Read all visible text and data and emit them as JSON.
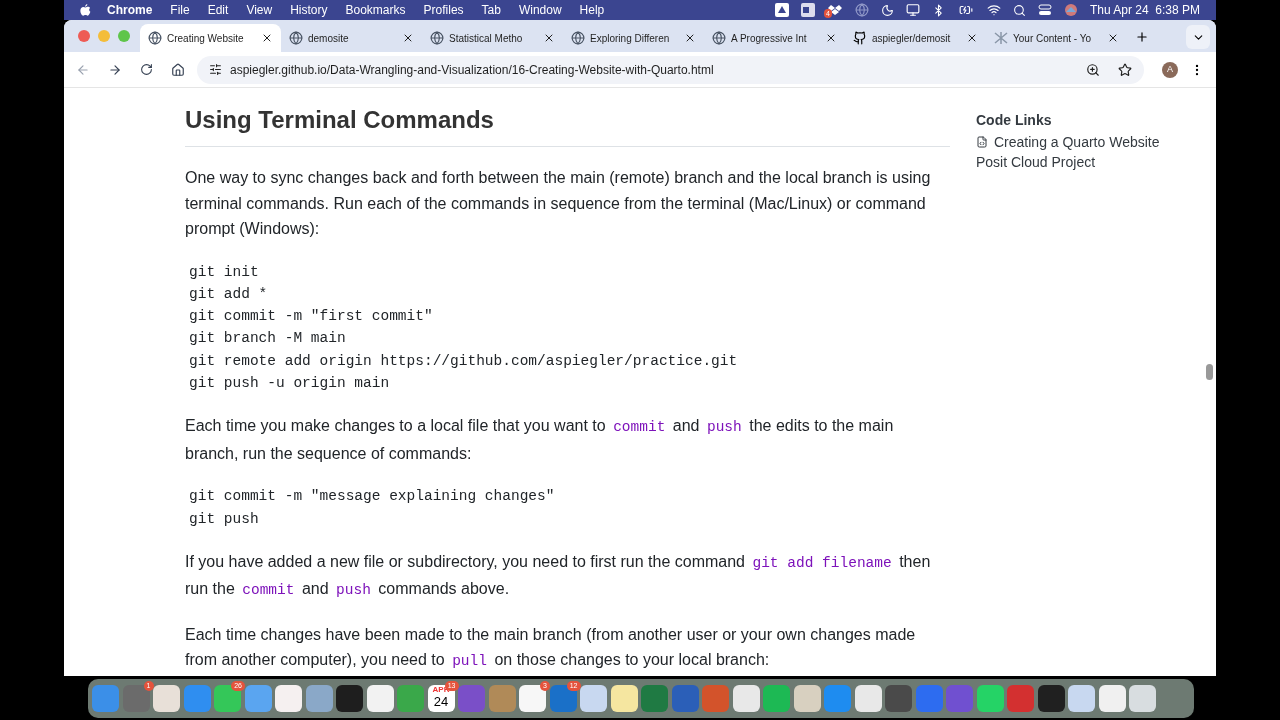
{
  "menu_bar": {
    "items": [
      "Chrome",
      "File",
      "Edit",
      "View",
      "History",
      "Bookmarks",
      "Profiles",
      "Tab",
      "Window",
      "Help"
    ],
    "dropbox_badge": "4",
    "clock": "Thu Apr 24  6:38 PM"
  },
  "tabs": [
    {
      "title": "Creating Website",
      "kind": "globe",
      "selected": true
    },
    {
      "title": "demosite",
      "kind": "globe",
      "selected": false
    },
    {
      "title": "Statistical Metho",
      "kind": "globe",
      "selected": false
    },
    {
      "title": "Exploring Differen",
      "kind": "globe",
      "selected": false
    },
    {
      "title": "A Progressive Int",
      "kind": "globe",
      "selected": false
    },
    {
      "title": "aspiegler/demosit",
      "kind": "github",
      "selected": false
    },
    {
      "title": "Your Content - Yo",
      "kind": "quarto",
      "selected": false
    }
  ],
  "address_bar": {
    "url": "aspiegler.github.io/Data-Wrangling-and-Visualization/16-Creating-Website-with-Quarto.html",
    "profile_initial": "A"
  },
  "article": {
    "heading": "Using Terminal Commands",
    "blocks": [
      {
        "kind": "paragraph",
        "segments": [
          {
            "text": "One way to sync changes back and forth between the main (remote) branch and the local branch is using terminal commands. Run each of the commands in sequence from the terminal (Mac/Linux) or command prompt (Windows):",
            "code": false
          }
        ]
      },
      {
        "kind": "code",
        "lines": [
          "git init",
          "git add *",
          "git commit -m \"first commit\"",
          "git branch -M main",
          "git remote add origin https://github.com/aspiegler/practice.git",
          "git push -u origin main"
        ]
      },
      {
        "kind": "paragraph",
        "segments": [
          {
            "text": "Each time you make changes to a local file that you want to ",
            "code": false
          },
          {
            "text": "commit",
            "code": true
          },
          {
            "text": " and ",
            "code": false
          },
          {
            "text": "push",
            "code": true
          },
          {
            "text": " the edits to the main branch, run the sequence of commands:",
            "code": false
          }
        ]
      },
      {
        "kind": "code",
        "lines": [
          "git commit -m \"message explaining changes\"",
          "git push"
        ]
      },
      {
        "kind": "paragraph",
        "segments": [
          {
            "text": "If you have added a new file or subdirectory, you need to first run the command ",
            "code": false
          },
          {
            "text": "git add filename",
            "code": true
          },
          {
            "text": " then run the ",
            "code": false
          },
          {
            "text": "commit",
            "code": true
          },
          {
            "text": " and ",
            "code": false
          },
          {
            "text": "push",
            "code": true
          },
          {
            "text": " commands above.",
            "code": false
          }
        ]
      },
      {
        "kind": "paragraph",
        "segments": [
          {
            "text": "Each time changes have been made to the main branch (from another user or your own changes made from another computer), you need to ",
            "code": false
          },
          {
            "text": "pull",
            "code": true
          },
          {
            "text": " on those changes to your local branch:",
            "code": false
          }
        ]
      }
    ]
  },
  "sidebar": {
    "title": "Code Links",
    "links": [
      {
        "text": "Creating a Quarto Website",
        "icon": true
      },
      {
        "text": "Posit Cloud Project",
        "icon": false
      }
    ]
  },
  "dock": [
    {
      "color": "#3b8fe8"
    },
    {
      "color": "#6b6b6b",
      "badge": "1"
    },
    {
      "color": "#e8e0d8"
    },
    {
      "color": "#2f8ef0"
    },
    {
      "color": "#34c759",
      "badge": "26"
    },
    {
      "color": "#5aa5f0"
    },
    {
      "color": "#f5f0f0"
    },
    {
      "color": "#8aa8c8"
    },
    {
      "color": "#1e1e1e"
    },
    {
      "color": "#f2f2f2"
    },
    {
      "color": "#3aa84a"
    },
    {
      "color": "#ffffff",
      "badge": "13",
      "month": "APR",
      "day": "24"
    },
    {
      "color": "#7a4fc8"
    },
    {
      "color": "#b08a58"
    },
    {
      "color": "#f7f7f7",
      "badge": "3"
    },
    {
      "color": "#1a70c8",
      "badge": "12"
    },
    {
      "color": "#c8d8f0"
    },
    {
      "color": "#f5e6a0"
    },
    {
      "color": "#1f7a43"
    },
    {
      "color": "#2b5fb8"
    },
    {
      "color": "#d3532b"
    },
    {
      "color": "#e8e8e8"
    },
    {
      "color": "#1db954"
    },
    {
      "color": "#d8d0c0"
    },
    {
      "color": "#1e8cf0"
    },
    {
      "color": "#e8e8e8"
    },
    {
      "color": "#4a4a4a"
    },
    {
      "color": "#2d6cf0"
    },
    {
      "color": "#7050d0"
    },
    {
      "color": "#25d366"
    },
    {
      "color": "#d33030"
    },
    {
      "color": "#202020"
    },
    {
      "color": "#c8d8f0"
    },
    {
      "color": "#f0f0f0"
    },
    {
      "color": "#d8dde0"
    }
  ]
}
